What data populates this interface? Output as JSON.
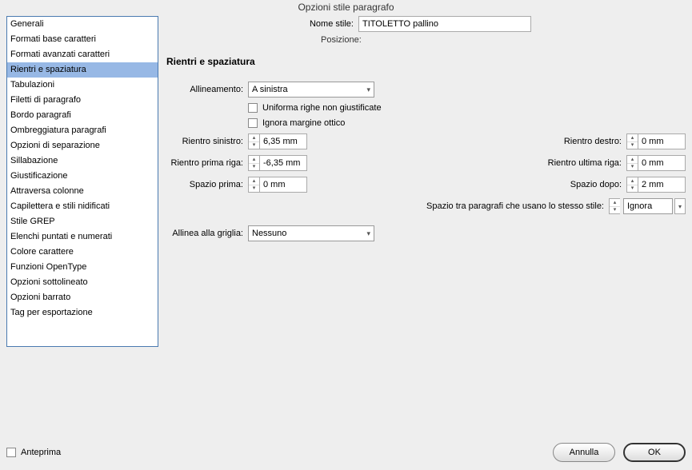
{
  "window": {
    "title": "Opzioni stile paragrafo"
  },
  "sidebar": {
    "items": [
      "Generali",
      "Formati base caratteri",
      "Formati avanzati caratteri",
      "Rientri e spaziatura",
      "Tabulazioni",
      "Filetti di paragrafo",
      "Bordo paragrafi",
      "Ombreggiatura paragrafi",
      "Opzioni di separazione",
      "Sillabazione",
      "Giustificazione",
      "Attraversa colonne",
      "Capilettera e stili nidificati",
      "Stile GREP",
      "Elenchi puntati e numerati",
      "Colore carattere",
      "Funzioni OpenType",
      "Opzioni sottolineato",
      "Opzioni barrato",
      "Tag per esportazione"
    ],
    "selectedIndex": 3
  },
  "header": {
    "nome_label": "Nome stile:",
    "nome_value": "TITOLETTO pallino",
    "posizione_label": "Posizione:"
  },
  "section": {
    "title": "Rientri e spaziatura"
  },
  "fields": {
    "allineamento_label": "Allineamento:",
    "allineamento_value": "A sinistra",
    "uniforma_label": "Uniforma righe non giustificate",
    "ignora_label": "Ignora margine ottico",
    "rientro_sinistro_label": "Rientro sinistro:",
    "rientro_sinistro_value": "6,35 mm",
    "rientro_destro_label": "Rientro destro:",
    "rientro_destro_value": "0 mm",
    "rientro_prima_riga_label": "Rientro prima riga:",
    "rientro_prima_riga_value": "-6,35 mm",
    "rientro_ultima_riga_label": "Rientro ultima riga:",
    "rientro_ultima_riga_value": "0 mm",
    "spazio_prima_label": "Spazio prima:",
    "spazio_prima_value": "0 mm",
    "spazio_dopo_label": "Spazio dopo:",
    "spazio_dopo_value": "2 mm",
    "spazio_tra_label": "Spazio tra paragrafi che usano lo stesso stile:",
    "spazio_tra_value": "Ignora",
    "allinea_griglia_label": "Allinea alla griglia:",
    "allinea_griglia_value": "Nessuno"
  },
  "footer": {
    "preview_label": "Anteprima",
    "cancel_label": "Annulla",
    "ok_label": "OK"
  }
}
